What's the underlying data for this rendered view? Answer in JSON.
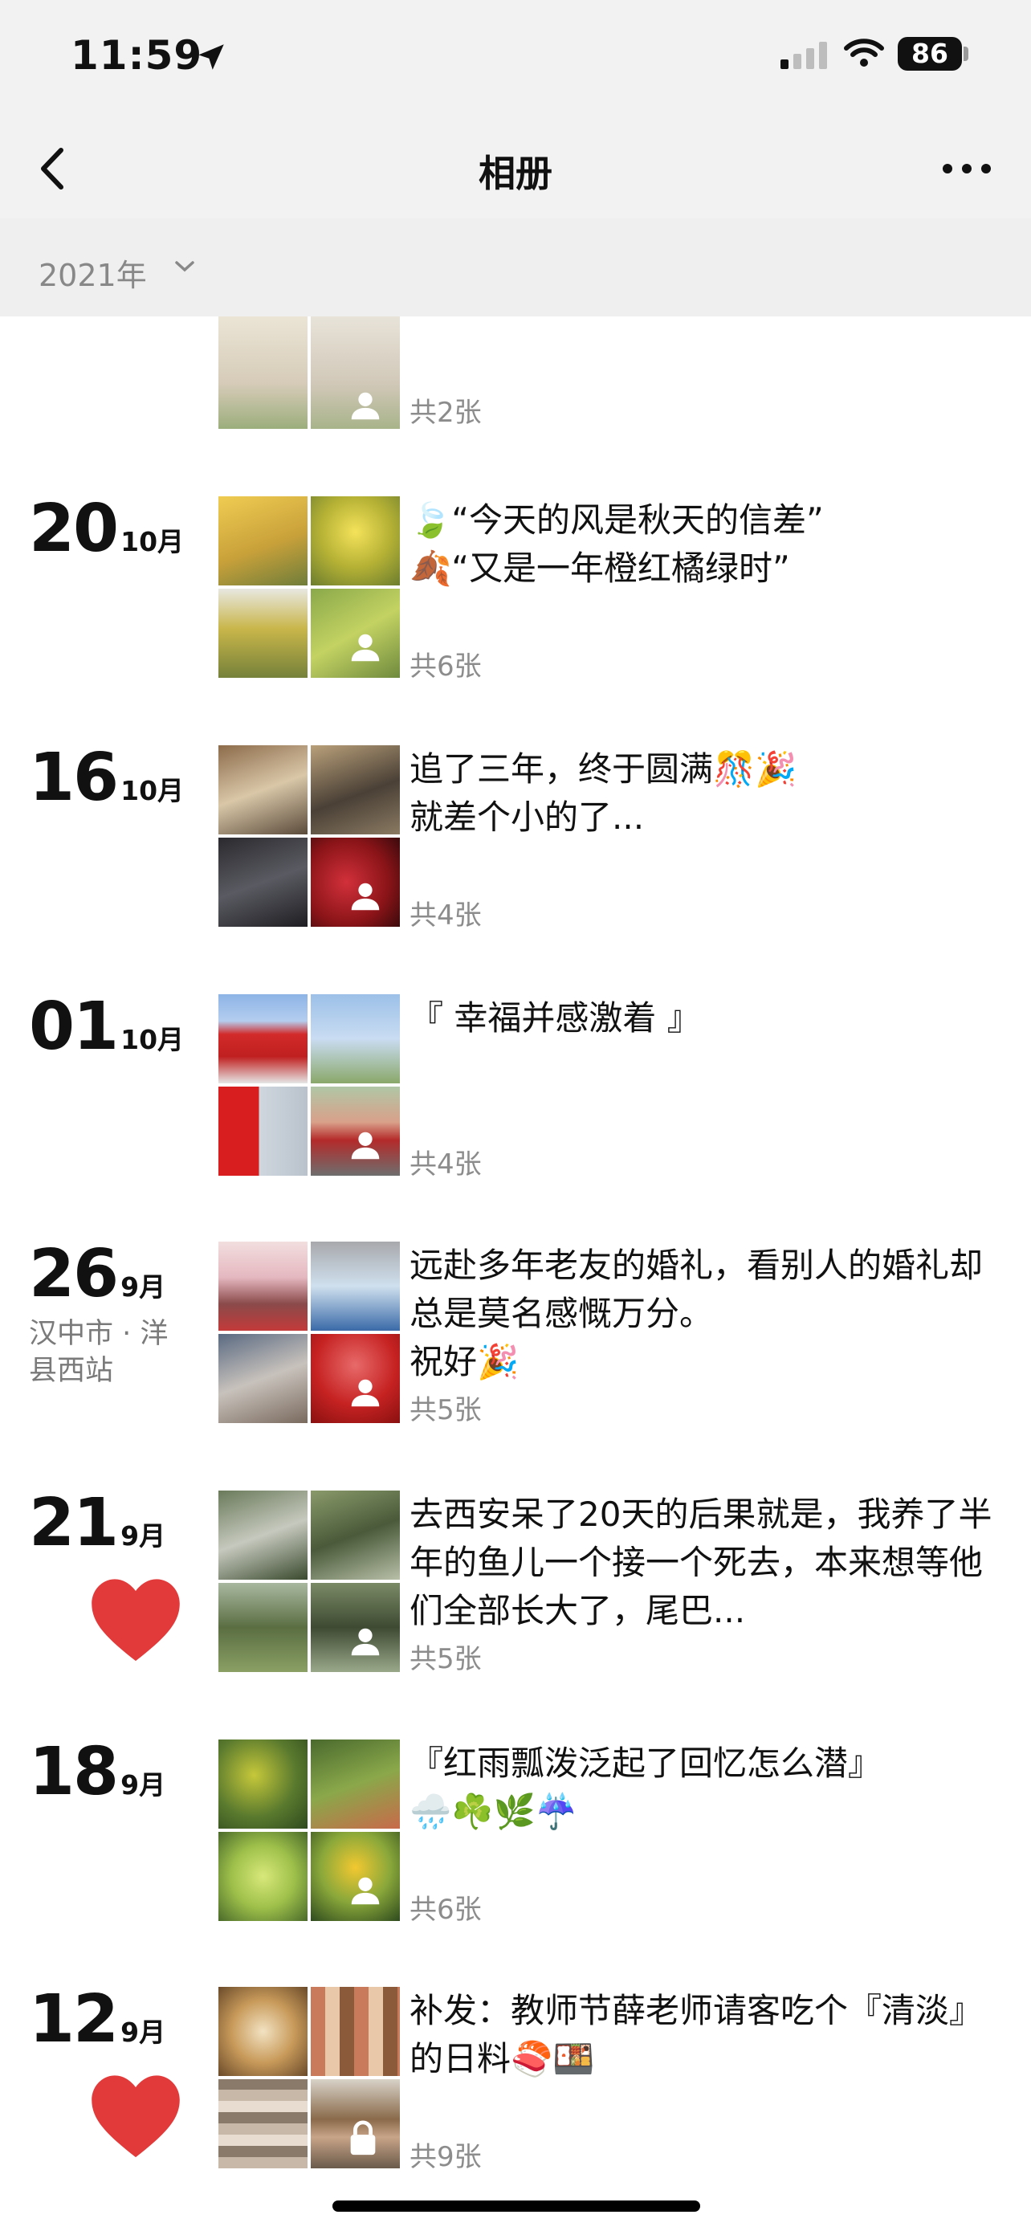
{
  "status_bar": {
    "time": "11:59",
    "battery": "86"
  },
  "nav": {
    "title": "相册"
  },
  "filter": {
    "year": "2021年"
  },
  "entries": [
    {
      "day": "",
      "month": "",
      "location": "",
      "caption": "",
      "count": "共2张"
    },
    {
      "day": "20",
      "month": "10月",
      "location": "",
      "caption": "🍃“今天的风是秋天的信差”\n🍂“又是一年橙红橘绿时”",
      "count": "共6张"
    },
    {
      "day": "16",
      "month": "10月",
      "location": "",
      "caption": "追了三年，终于圆满🎊🎉\n就差个小的了...",
      "count": "共4张"
    },
    {
      "day": "01",
      "month": "10月",
      "location": "",
      "caption": "『 幸福并感激着 』",
      "count": "共4张"
    },
    {
      "day": "26",
      "month": "9月",
      "location": "汉中市 · 洋县西站",
      "caption": "远赴多年老友的婚礼，看别人的婚礼却总是莫名感慨万分。\n祝好🎉",
      "count": "共5张"
    },
    {
      "day": "21",
      "month": "9月",
      "location": "",
      "caption": "去西安呆了20天的后果就是，我养了半年的鱼儿一个接一个死去，本来想等他们全部长大了，尾巴...",
      "count": "共5张"
    },
    {
      "day": "18",
      "month": "9月",
      "location": "",
      "caption": "『红雨瓢泼泛起了回忆怎么潜』\n🌧️☘️🌿☔️",
      "count": "共6张"
    },
    {
      "day": "12",
      "month": "9月",
      "location": "",
      "caption": "补发：教师节薛老师请客吃个『清淡』的日料🍣🍱",
      "count": "共9张"
    }
  ],
  "colors": {
    "heart": "#e23a3a",
    "nav_bg": "#f2f2f2",
    "muted": "#8c8c8c"
  },
  "icons": [
    "location-arrow-icon",
    "signal-icon",
    "wifi-icon",
    "back-chevron-icon",
    "more-icon",
    "chevron-down-icon",
    "people-icon",
    "heart-icon",
    "lock-icon"
  ]
}
